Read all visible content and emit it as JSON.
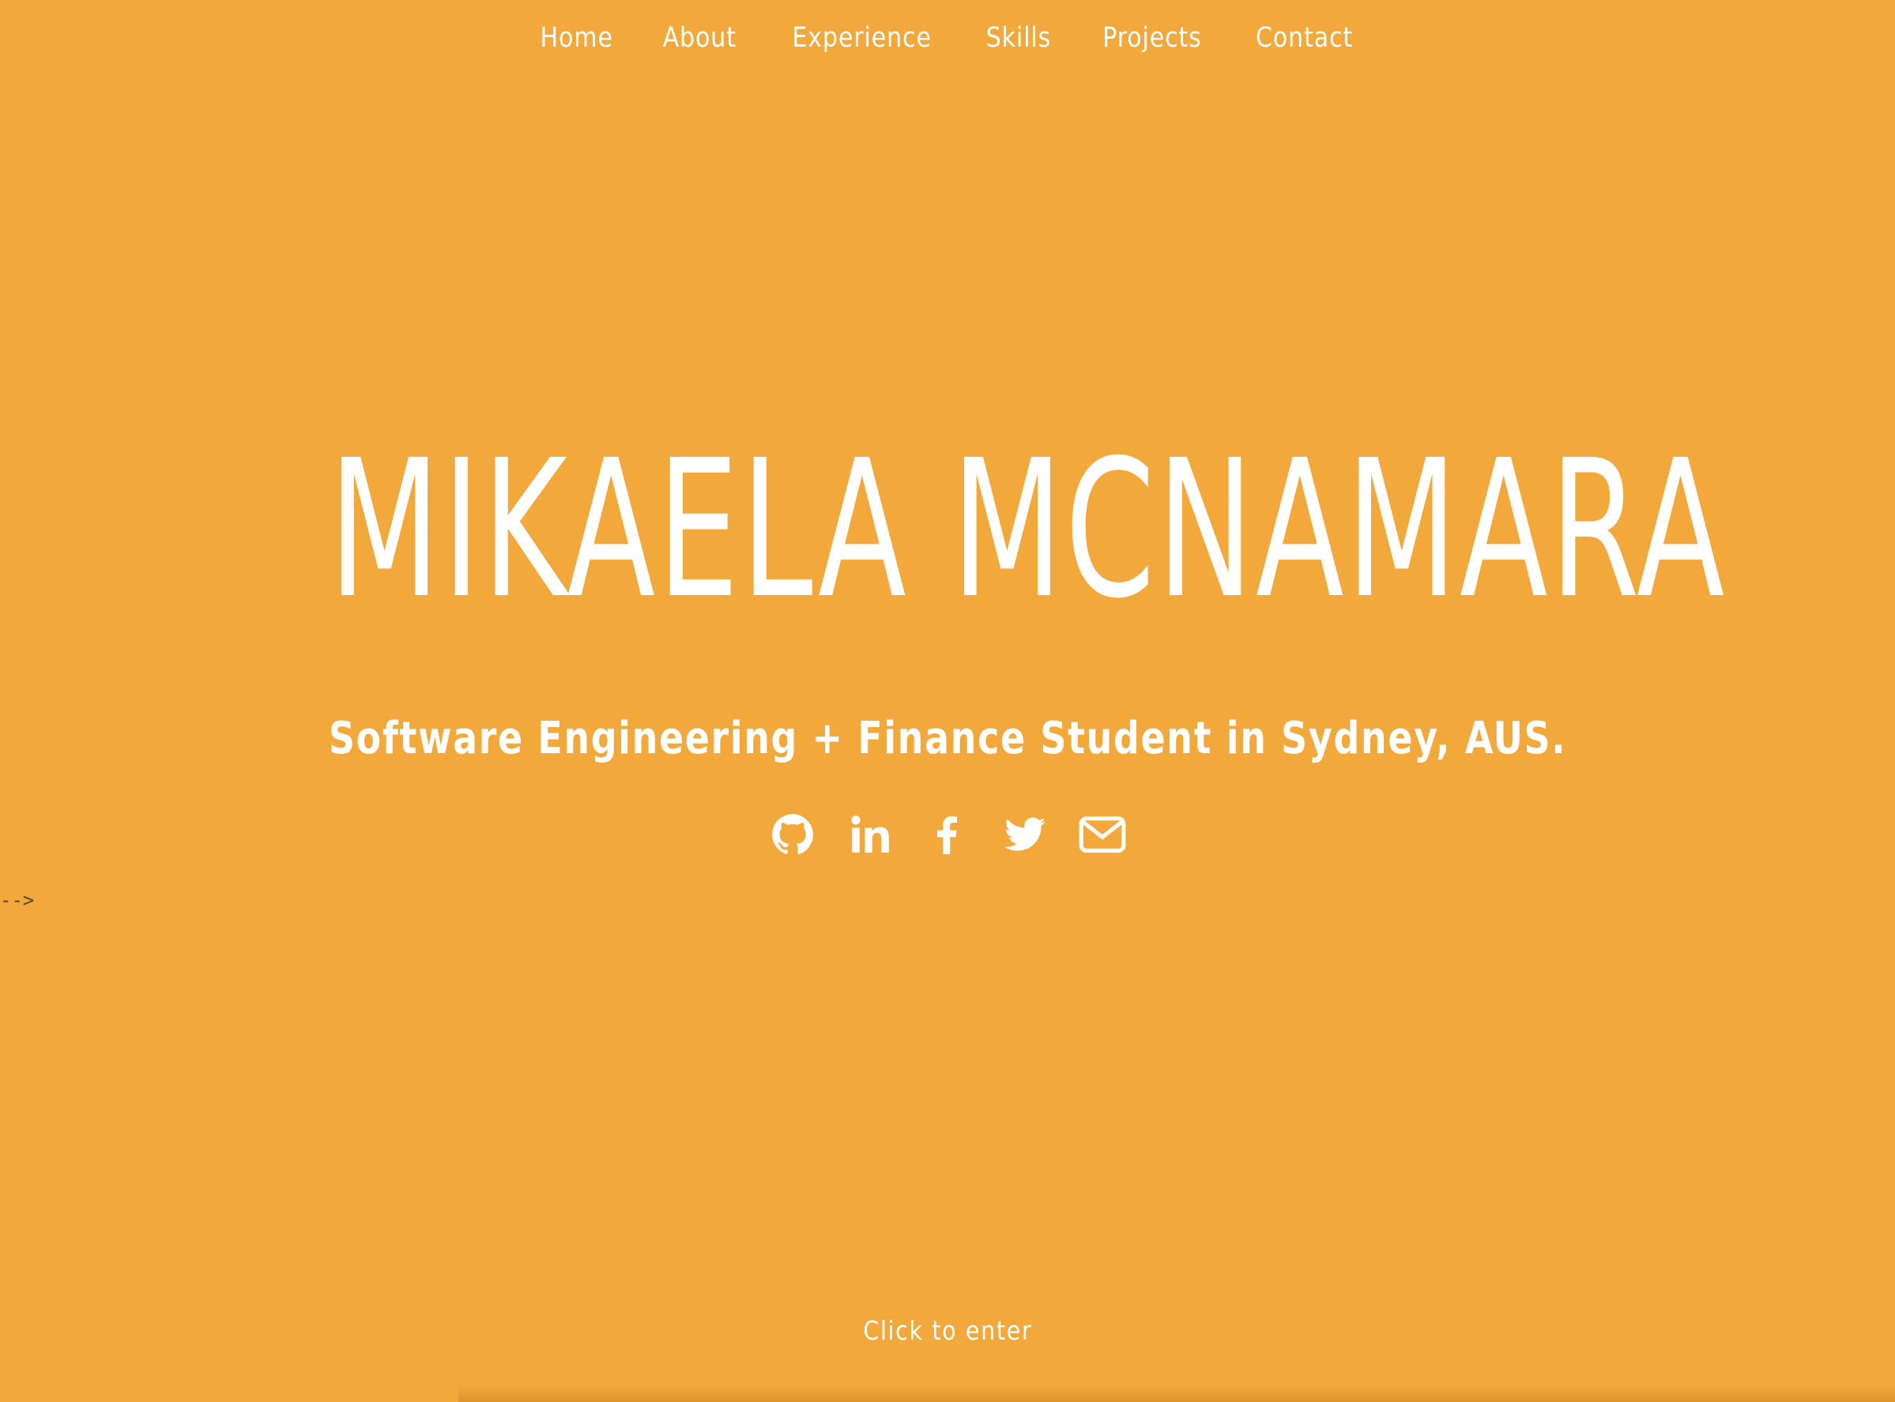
{
  "nav": {
    "items": [
      {
        "label": "Home"
      },
      {
        "label": "About"
      },
      {
        "label": "Experience"
      },
      {
        "label": "Skills"
      },
      {
        "label": "Projects"
      },
      {
        "label": "Contact"
      }
    ]
  },
  "hero": {
    "name": "MIKAELA MCNAMARA",
    "tagline": "Software Engineering + Finance Student in Sydney, AUS."
  },
  "social": {
    "icons": [
      "github-icon",
      "linkedin-icon",
      "facebook-icon",
      "twitter-icon",
      "envelope-icon"
    ]
  },
  "comment_remnant": "-->",
  "enter_label": "Click to enter",
  "colors": {
    "background": "#F2A83B",
    "text": "#FFFFFF"
  }
}
